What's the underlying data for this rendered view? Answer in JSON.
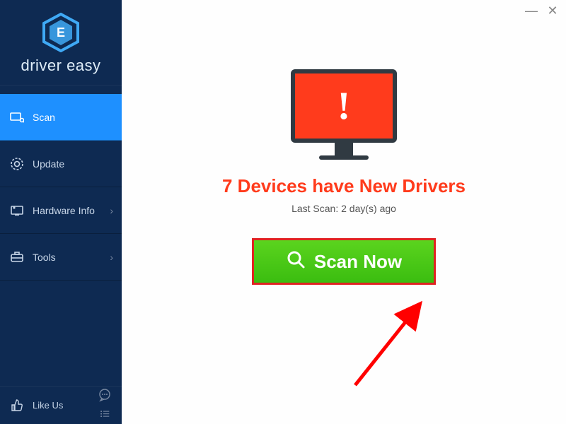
{
  "logo": {
    "brand": "driver easy",
    "sub": ""
  },
  "nav": {
    "scan": "Scan",
    "update": "Update",
    "hardware": "Hardware Info",
    "tools": "Tools",
    "like": "Like Us"
  },
  "main": {
    "headline": "7 Devices have New Drivers",
    "last_scan": "Last Scan: 2 day(s) ago",
    "scan_button": "Scan Now"
  }
}
